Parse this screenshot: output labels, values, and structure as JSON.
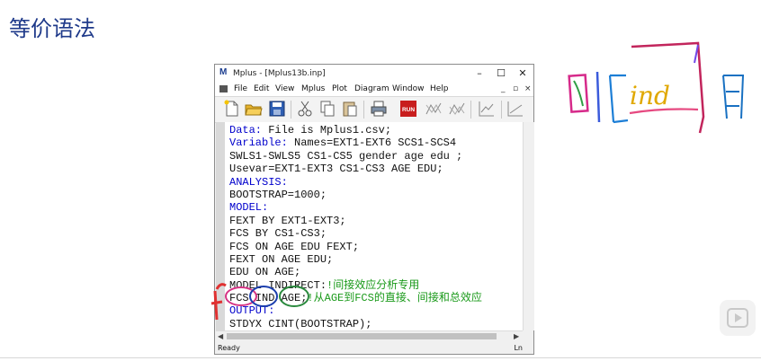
{
  "slide": {
    "title": "等价语法"
  },
  "window": {
    "title": "Mplus - [Mplus13b.inp]",
    "app_icon": "M",
    "controls": {
      "minimize": "–",
      "maximize": "☐",
      "close": "✕"
    },
    "mdi_controls": [
      "_",
      "▫",
      "×"
    ]
  },
  "menu": [
    "File",
    "Edit",
    "View",
    "Mplus",
    "Plot",
    "Diagram",
    "Window",
    "Help"
  ],
  "toolbar": {
    "buttons": [
      "new-file-icon",
      "open-folder-icon",
      "save-icon",
      "cut-icon",
      "copy-icon",
      "paste-icon",
      "print-icon",
      "run-button",
      "diagram-icon",
      "diagram-2-icon",
      "plot-icon",
      "plot-2-icon"
    ],
    "run_label": "RUN"
  },
  "editor": {
    "lines": [
      {
        "keyword": "Data:",
        "text": " File is Mplus1.csv;"
      },
      {
        "keyword": "Variable:",
        "text": " Names=EXT1-EXT6 SCS1-SCS4"
      },
      {
        "keyword": "",
        "text": "SWLS1-SWLS5 CS1-CS5 gender age edu ;"
      },
      {
        "keyword": "",
        "text": "Usevar=EXT1-EXT3 CS1-CS3 AGE EDU;"
      },
      {
        "keyword": "ANALYSIS:",
        "text": ""
      },
      {
        "keyword": "",
        "text": "BOOTSTRAP=1000;"
      },
      {
        "keyword": "MODEL:",
        "text": ""
      },
      {
        "keyword": "",
        "text": "FEXT BY EXT1-EXT3;"
      },
      {
        "keyword": "",
        "text": "FCS BY CS1-CS3;"
      },
      {
        "keyword": "",
        "text": "FCS ON AGE EDU FEXT;"
      },
      {
        "keyword": "",
        "text": "FEXT ON AGE EDU;"
      },
      {
        "keyword": "",
        "text": "EDU ON AGE;"
      },
      {
        "keyword": "",
        "text": "MODEL INDIRECT:",
        "comment": "!间接效应分析专用"
      },
      {
        "keyword": "",
        "text": "FCS IND AGE;",
        "comment": "!从AGE到FCS的直接、间接和总效应"
      },
      {
        "keyword": "OUTPUT:",
        "text": ""
      },
      {
        "keyword": "",
        "text": "STDYX CINT(BOOTSTRAP);"
      }
    ]
  },
  "status": {
    "left": "Ready",
    "right": "Ln"
  },
  "annotation": {
    "handwritten_text": "回[ind]百"
  },
  "colors": {
    "keyword": "#0000cc",
    "comment": "#1a9a1a",
    "title": "#1f3a8a"
  }
}
